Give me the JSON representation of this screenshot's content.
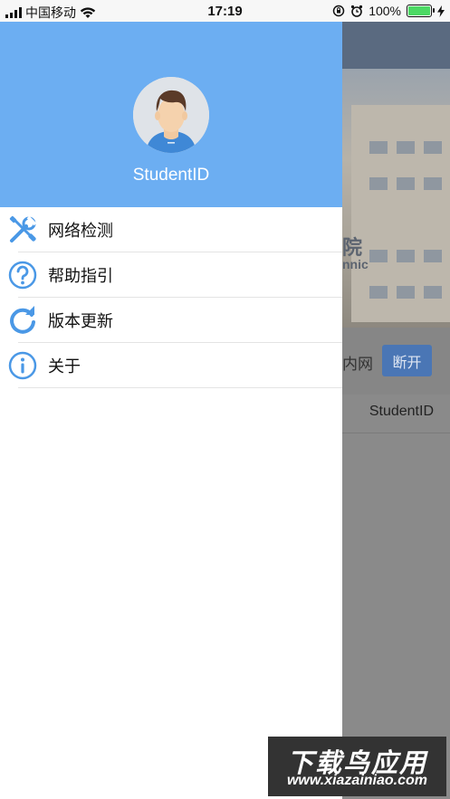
{
  "status_bar": {
    "carrier": "中国移动",
    "time": "17:19",
    "battery": "100%",
    "battery_level": 1.0
  },
  "drawer": {
    "username": "StudentID",
    "menu": [
      {
        "label": "网络检测",
        "icon": "tools-icon"
      },
      {
        "label": "帮助指引",
        "icon": "help-icon"
      },
      {
        "label": "版本更新",
        "icon": "refresh-icon"
      },
      {
        "label": "关于",
        "icon": "info-icon"
      }
    ]
  },
  "background_page": {
    "sign_cn": "院",
    "sign_en": "nnic",
    "network_label": "内网",
    "disconnect_button": "断开",
    "student_id": "StudentID"
  },
  "watermark": {
    "title": "下载鸟应用",
    "url": "www.xiazainiao.com"
  },
  "colors": {
    "header": "#6caef2",
    "icon": "#4a98e6"
  }
}
